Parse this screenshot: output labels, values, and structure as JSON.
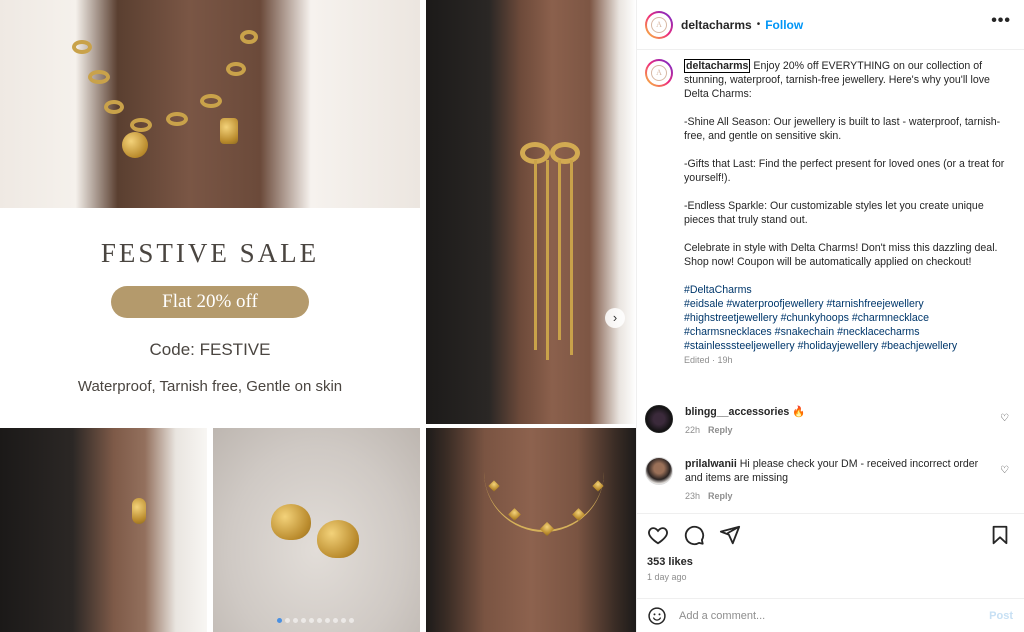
{
  "sale_image": {
    "title": "FESTIVE SALE",
    "pill": "Flat 20%  off",
    "code": "Code: FESTIVE",
    "features": "Waterproof, Tarnish free, Gentle on skin"
  },
  "carousel": {
    "dots_total": 10,
    "active_index": 0,
    "next_icon": "chevron-right-icon"
  },
  "header": {
    "username": "deltacharms",
    "separator": "•",
    "follow": "Follow",
    "more": "•••",
    "avatar_logo": "A"
  },
  "caption": {
    "username": "deltacharms",
    "paragraphs": [
      "Enjoy 20% off EVERYTHING on our collection of stunning, waterproof, tarnish-free jewellery. Here's why you'll love Delta Charms:",
      "-Shine All Season: Our jewellery is built to last - waterproof, tarnish-free, and gentle on sensitive skin.",
      "-Gifts that Last: Find the perfect present for loved ones (or a treat for yourself!).",
      "-Endless Sparkle: Our customizable styles let you create unique pieces that truly stand out.",
      "Celebrate in style with Delta Charms! Don't miss this dazzling deal. Shop now! Coupon will be automatically applied on checkout!"
    ],
    "hashtags": "#DeltaCharms\n#eidsale #waterproofjewellery #tarnishfreejewellery\n#highstreetjewellery #chunkyhoops #charmnecklace\n#charmsnecklaces #snakechain #necklacecharms\n#stainlesssteeljewellery #holidayjewellery #beachjewellery",
    "edited": "Edited · 19h"
  },
  "comments": [
    {
      "username": "blingg__accessories",
      "text": "🔥",
      "time": "22h",
      "reply": "Reply"
    },
    {
      "username": "prilalwanii",
      "text": "Hi please check your DM - received incorrect order and items are missing",
      "time": "23h",
      "reply": "Reply"
    }
  ],
  "actions": {
    "likes": "353 likes",
    "time": "1 day ago",
    "icons": [
      "heart-icon",
      "comment-icon",
      "share-icon",
      "bookmark-icon"
    ]
  },
  "comment_box": {
    "placeholder": "Add a comment...",
    "post": "Post"
  }
}
